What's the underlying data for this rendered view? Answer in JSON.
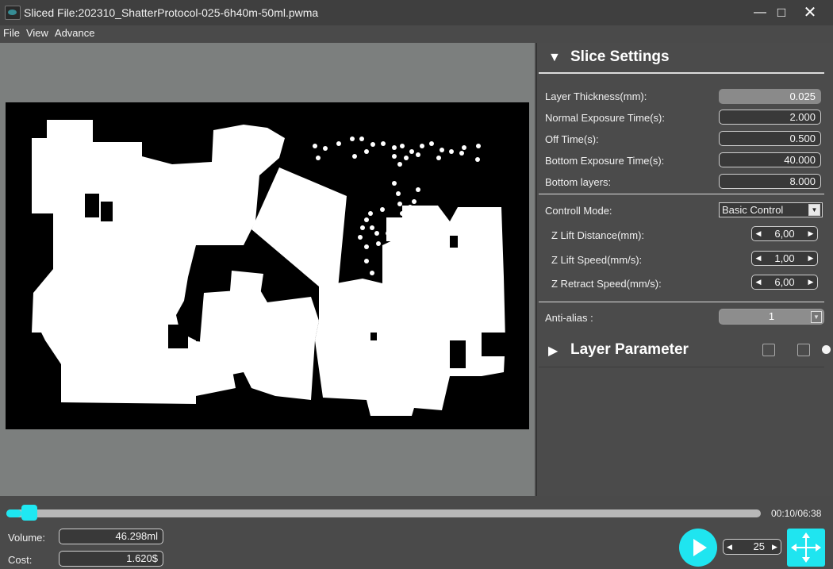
{
  "window": {
    "title": "Sliced File:202310_ShatterProtocol-025-6h40m-50ml.pwma",
    "minimize": "—",
    "maximize": "□",
    "close": "✕"
  },
  "menu": [
    {
      "label": "File"
    },
    {
      "label": "View"
    },
    {
      "label": "Advance"
    }
  ],
  "slice_settings": {
    "title": "Slice Settings",
    "layer_thickness": {
      "label": "Layer Thickness(mm):",
      "value": "0.025"
    },
    "normal_exposure": {
      "label": "Normal Exposure Time(s):",
      "value": "2.000"
    },
    "off_time": {
      "label": "Off Time(s):",
      "value": "0.500"
    },
    "bottom_exposure": {
      "label": "Bottom Exposure Time(s):",
      "value": "40.000"
    },
    "bottom_layers": {
      "label": "Bottom layers:",
      "value": "8.000"
    },
    "control_mode": {
      "label": "Controll Mode:",
      "value": "Basic Control"
    },
    "z_lift_distance": {
      "label": "Z Lift Distance(mm):",
      "value": "6,00"
    },
    "z_lift_speed": {
      "label": "Z Lift Speed(mm/s):",
      "value": "1,00"
    },
    "z_retract_speed": {
      "label": "Z Retract Speed(mm/s):",
      "value": "6,00"
    },
    "anti_alias": {
      "label": "Anti-alias :",
      "value": "1"
    }
  },
  "layer_parameter": {
    "title": "Layer Parameter",
    "icons": [
      "export-icon",
      "import-icon",
      "dot-icon"
    ]
  },
  "playback": {
    "time": "00:10/06:38",
    "progress": 0.02,
    "speed": "25"
  },
  "info": {
    "volume": {
      "label": "Volume:",
      "value": "46.298ml"
    },
    "cost": {
      "label": "Cost:",
      "value": "1.620$"
    }
  },
  "colors": {
    "accent": "#1fe5f0",
    "panel": "#4b4b4b",
    "viewport": "#7c7f7e"
  }
}
